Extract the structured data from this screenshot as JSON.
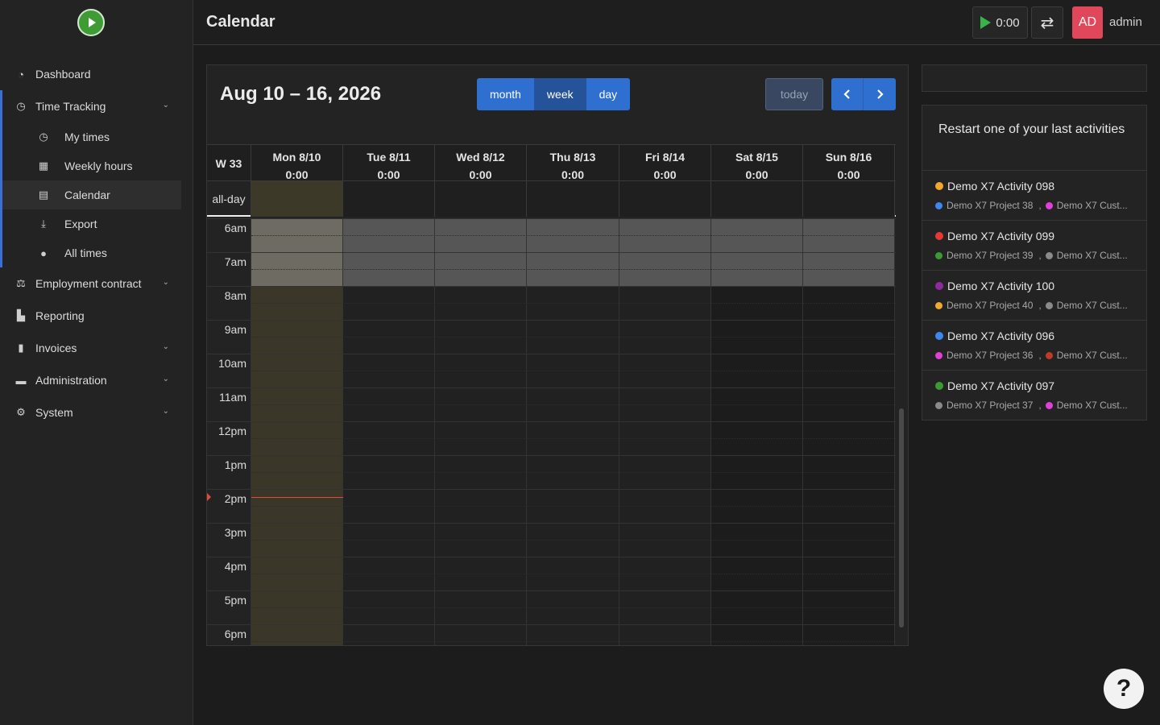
{
  "header": {
    "title": "Calendar",
    "timer": "0:00",
    "avatar_initials": "AD",
    "avatar_color": "#e0475b",
    "username": "admin"
  },
  "sidebar": {
    "items": [
      {
        "label": "Dashboard",
        "icon": "dashboard-icon"
      },
      {
        "label": "Time Tracking",
        "icon": "clock-icon",
        "expanded": true
      },
      {
        "label": "Employment contract",
        "icon": "scale-icon"
      },
      {
        "label": "Reporting",
        "icon": "chart-icon"
      },
      {
        "label": "Invoices",
        "icon": "file-icon"
      },
      {
        "label": "Administration",
        "icon": "toolbox-icon"
      },
      {
        "label": "System",
        "icon": "gear-icon"
      }
    ],
    "time_tracking_sub": [
      {
        "label": "My times",
        "icon": "clock-icon"
      },
      {
        "label": "Weekly hours",
        "icon": "table-icon"
      },
      {
        "label": "Calendar",
        "icon": "calendar-icon",
        "active": true
      },
      {
        "label": "Export",
        "icon": "download-icon"
      },
      {
        "label": "All times",
        "icon": "users-clock-icon"
      }
    ]
  },
  "calendar": {
    "range_title": "Aug 10 – 16, 2026",
    "views": {
      "month": "month",
      "week": "week",
      "day": "day"
    },
    "today_label": "today",
    "week_label": "W 33",
    "allday_label": "all-day",
    "days": [
      {
        "name": "Mon 8/10",
        "total": "0:00"
      },
      {
        "name": "Tue 8/11",
        "total": "0:00"
      },
      {
        "name": "Wed 8/12",
        "total": "0:00"
      },
      {
        "name": "Thu 8/13",
        "total": "0:00"
      },
      {
        "name": "Fri 8/14",
        "total": "0:00"
      },
      {
        "name": "Sat 8/15",
        "total": "0:00"
      },
      {
        "name": "Sun 8/16",
        "total": "0:00"
      }
    ],
    "hours": [
      "6am",
      "7am",
      "8am",
      "9am",
      "10am",
      "11am",
      "12pm",
      "1pm",
      "2pm",
      "3pm",
      "4pm",
      "5pm",
      "6pm"
    ]
  },
  "recent": {
    "title": "Restart one of your last activities",
    "activities": [
      {
        "name": "Demo X7 Activity 098",
        "color": "#f0a830",
        "project": "Demo X7 Project 38",
        "project_color": "#3f87f0",
        "customer": "Demo X7 Cust...",
        "customer_color": "#e040d8"
      },
      {
        "name": "Demo X7 Activity 099",
        "color": "#e53935",
        "project": "Demo X7 Project 39",
        "project_color": "#3c9a34",
        "customer": "Demo X7 Cust...",
        "customer_color": "#8a8a8a"
      },
      {
        "name": "Demo X7 Activity 100",
        "color": "#8e2aa0",
        "project": "Demo X7 Project 40",
        "project_color": "#f0a830",
        "customer": "Demo X7 Cust...",
        "customer_color": "#8a8a8a"
      },
      {
        "name": "Demo X7 Activity 096",
        "color": "#3f87f0",
        "project": "Demo X7 Project 36",
        "project_color": "#e040d8",
        "customer": "Demo X7 Cust...",
        "customer_color": "#c0392b"
      },
      {
        "name": "Demo X7 Activity 097",
        "color": "#3c9a34",
        "project": "Demo X7 Project 37",
        "project_color": "#8a8a8a",
        "customer": "Demo X7 Cust...",
        "customer_color": "#e040d8"
      }
    ]
  },
  "help": {
    "label": "?"
  }
}
